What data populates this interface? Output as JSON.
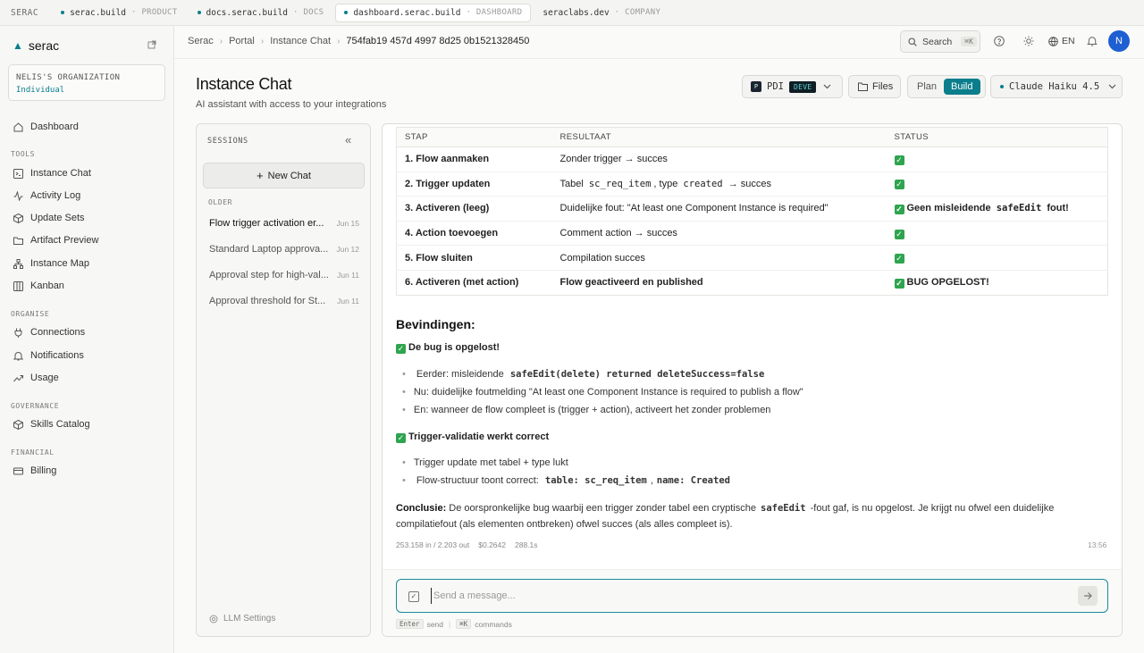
{
  "topbar": {
    "brand": "SERAC",
    "tabs": [
      {
        "name": "serac.build",
        "tag": "· PRODUCT",
        "dot": true,
        "active": false
      },
      {
        "name": "docs.serac.build",
        "tag": "· DOCS",
        "dot": true,
        "active": false
      },
      {
        "name": "dashboard.serac.build",
        "tag": "· DASHBOARD",
        "dot": true,
        "active": true
      },
      {
        "name": "seraclabs.dev",
        "tag": "· COMPANY",
        "dot": false,
        "active": false
      }
    ]
  },
  "sidebar": {
    "logo": "serac",
    "org_name": "NELIS'S ORGANIZATION",
    "org_plan": "Individual",
    "dashboard": "Dashboard",
    "sections": {
      "tools": "TOOLS",
      "organise": "ORGANISE",
      "governance": "GOVERNANCE",
      "financial": "FINANCIAL"
    },
    "tools": [
      "Instance Chat",
      "Activity Log",
      "Update Sets",
      "Artifact Preview",
      "Instance Map",
      "Kanban"
    ],
    "organise": [
      "Connections",
      "Notifications",
      "Usage"
    ],
    "governance": [
      "Skills Catalog"
    ],
    "financial": [
      "Billing"
    ]
  },
  "header": {
    "crumbs": [
      "Serac",
      "Portal",
      "Instance Chat",
      "754fab19 457d 4997 8d25 0b1521328450"
    ],
    "search_label": "Search",
    "search_kbd": "⌘K",
    "lang": "EN",
    "avatar": "N"
  },
  "page": {
    "title": "Instance Chat",
    "subtitle": "AI assistant with access to your integrations",
    "instance": "PDI",
    "instance_badge": "P",
    "env": "DEVE",
    "files": "Files",
    "mode_plan": "Plan",
    "mode_build": "Build",
    "model": "Claude Haiku 4.5"
  },
  "sessions": {
    "header": "SESSIONS",
    "new_chat": "New Chat",
    "older": "OLDER",
    "items": [
      {
        "title": "Flow trigger activation er...",
        "date": "Jun 15"
      },
      {
        "title": "Standard Laptop approva...",
        "date": "Jun 12"
      },
      {
        "title": "Approval step for high-val...",
        "date": "Jun 11"
      },
      {
        "title": "Approval threshold for St...",
        "date": "Jun 11"
      }
    ],
    "llm_settings": "LLM Settings"
  },
  "chat": {
    "table": {
      "headers": [
        "STAP",
        "RESULTAAT",
        "STATUS"
      ],
      "rows": [
        {
          "step": "1. Flow aanmaken",
          "result": "Zonder trigger → succes",
          "status": ""
        },
        {
          "step": "2. Trigger updaten",
          "result_a": "Tabel",
          "result_code1": "sc_req_item",
          "result_b": ", type",
          "result_code2": "created",
          "result_c": "→ succes",
          "status": ""
        },
        {
          "step": "3. Activeren (leeg)",
          "result": "Duidelijke fout: \"At least one Component Instance is required\"",
          "status_a": "Geen misleidende",
          "status_code": "safeEdit",
          "status_b": "fout!"
        },
        {
          "step": "4. Action toevoegen",
          "result": "Comment action → succes",
          "status": ""
        },
        {
          "step": "5. Flow sluiten",
          "result": "Compilation succes",
          "status": ""
        },
        {
          "step": "6. Activeren (met action)",
          "result": "Flow geactiveerd en published",
          "status": "BUG OPGELOST!"
        }
      ]
    },
    "findings_title": "Bevindingen:",
    "finding1": "De bug is opgelost!",
    "b1_a": "Eerder: misleidende",
    "b1_code": "safeEdit(delete) returned deleteSuccess=false",
    "b2": "Nu: duidelijke foutmelding \"At least one Component Instance is required to publish a flow\"",
    "b3": "En: wanneer de flow compleet is (trigger + action), activeert het zonder problemen",
    "finding2": "Trigger-validatie werkt correct",
    "b4": "Trigger update met tabel + type lukt",
    "b5_a": "Flow-structuur toont correct:",
    "b5_code1": "table: sc_req_item",
    "b5_sep": ",",
    "b5_code2": "name: Created",
    "concl_label": "Conclusie:",
    "concl_a": "De oorspronkelijke bug waarbij een trigger zonder tabel een cryptische",
    "concl_code": "safeEdit",
    "concl_b": "-fout gaf, is nu opgelost. Je krijgt nu ofwel een duidelijke compilatiefout (als elementen ontbreken) ofwel succes (als alles compleet is).",
    "meta_tokens": "253.158 in / 2.203 out",
    "meta_cost": "$0.2642",
    "meta_time": "288.1s",
    "timestamp": "13:56"
  },
  "composer": {
    "placeholder": "Send a message...",
    "hint_enter": "Enter",
    "hint_send": "send",
    "hint_cmdk": "⌘K",
    "hint_commands": "commands"
  },
  "colors": {
    "accent": "#0a7e8c",
    "avatar": "#1e5fd1",
    "success": "#2ea44f"
  }
}
